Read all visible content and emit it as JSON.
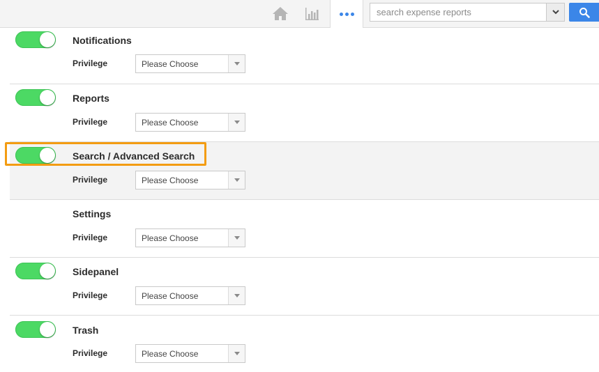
{
  "topbar": {
    "icons": {
      "home": "home-icon",
      "chart": "bar-chart-icon",
      "more": "more-dots-icon",
      "dropdown": "chevron-down-icon",
      "search": "search-icon"
    },
    "search": {
      "placeholder": "search expense reports",
      "value": ""
    },
    "accent_color": "#3b86e8"
  },
  "privilege_label": "Privilege",
  "sections": [
    {
      "title": "Notifications",
      "toggle_on": true,
      "privilege_value": "Please Choose"
    },
    {
      "title": "Reports",
      "toggle_on": true,
      "privilege_value": "Please Choose"
    },
    {
      "title": "Search / Advanced Search",
      "toggle_on": true,
      "privilege_value": "Please Choose",
      "highlighted": true
    },
    {
      "title": "Settings",
      "toggle_on": false,
      "privilege_value": "Please Choose"
    },
    {
      "title": "Sidepanel",
      "toggle_on": true,
      "privilege_value": "Please Choose"
    },
    {
      "title": "Trash",
      "toggle_on": true,
      "privilege_value": "Please Choose"
    }
  ],
  "colors": {
    "toggle_on": "#4cd964",
    "highlight_border": "#f39c12"
  }
}
